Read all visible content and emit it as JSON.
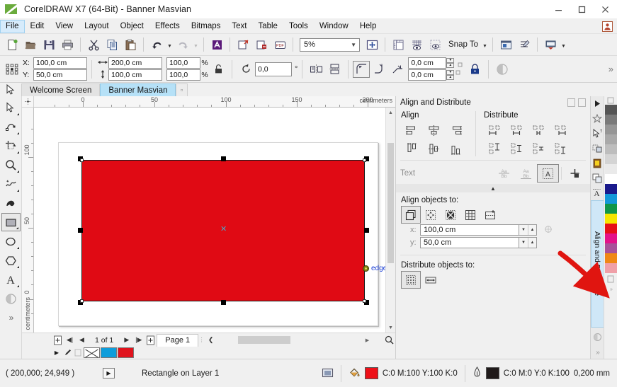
{
  "window": {
    "title": "CorelDRAW X7 (64-Bit) - Banner Masvian",
    "minimize": "—",
    "maximize": "□",
    "close": "✕"
  },
  "menubar": {
    "items": [
      {
        "label": "File"
      },
      {
        "label": "Edit"
      },
      {
        "label": "View"
      },
      {
        "label": "Layout"
      },
      {
        "label": "Object"
      },
      {
        "label": "Effects"
      },
      {
        "label": "Bitmaps"
      },
      {
        "label": "Text"
      },
      {
        "label": "Table"
      },
      {
        "label": "Tools"
      },
      {
        "label": "Window"
      },
      {
        "label": "Help"
      }
    ]
  },
  "toolbar": {
    "zoom_level": "5%",
    "snap_to_label": "Snap To",
    "buttons": [
      {
        "name": "new-document",
        "tip": "New"
      },
      {
        "name": "open-document",
        "tip": "Open"
      },
      {
        "name": "save-document",
        "tip": "Save"
      },
      {
        "name": "print-document",
        "tip": "Print"
      },
      {
        "name": "cut",
        "tip": "Cut"
      },
      {
        "name": "copy",
        "tip": "Copy"
      },
      {
        "name": "paste",
        "tip": "Paste"
      },
      {
        "name": "undo",
        "tip": "Undo"
      },
      {
        "name": "redo",
        "tip": "Redo"
      },
      {
        "name": "corel-connect",
        "tip": "Search Content"
      },
      {
        "name": "import",
        "tip": "Import"
      },
      {
        "name": "export",
        "tip": "Export"
      },
      {
        "name": "publish-pdf",
        "tip": "Publish to PDF"
      },
      {
        "name": "fullscreen-preview",
        "tip": "Full-Screen Preview"
      },
      {
        "name": "show-rulers",
        "tip": "Rulers"
      },
      {
        "name": "show-grid",
        "tip": "Grid"
      },
      {
        "name": "show-guidelines",
        "tip": "Guidelines"
      },
      {
        "name": "options",
        "tip": "Options"
      },
      {
        "name": "object-styles",
        "tip": "Object Styles"
      },
      {
        "name": "application-launcher",
        "tip": "Application Launcher"
      }
    ]
  },
  "propertybar": {
    "x_label": "X:",
    "y_label": "Y:",
    "x_value": "100,0 cm",
    "y_value": "50,0 cm",
    "width_value": "200,0 cm",
    "height_value": "100,0 cm",
    "scale_w": "100,0",
    "scale_h": "100,0",
    "percent": "%",
    "rotation": "0,0",
    "degree": "°",
    "outline_top": "0,0 cm",
    "outline_bottom": "0,0 cm",
    "overflow": "»"
  },
  "tabs": {
    "items": [
      {
        "label": "Welcome Screen",
        "active": false
      },
      {
        "label": "Banner Masvian",
        "active": true
      }
    ],
    "close_glyph": "▫"
  },
  "toolbox": {
    "tools": [
      {
        "name": "pick-tool",
        "label": "Pick",
        "selected": false
      },
      {
        "name": "shape-tool",
        "label": "Shape",
        "selected": false
      },
      {
        "name": "crop-tool",
        "label": "Crop",
        "selected": false
      },
      {
        "name": "zoom-tool",
        "label": "Zoom",
        "selected": false
      },
      {
        "name": "freehand-tool",
        "label": "Freehand",
        "selected": false
      },
      {
        "name": "artistic-media-tool",
        "label": "Artistic Media",
        "selected": false
      },
      {
        "name": "rectangle-tool",
        "label": "Rectangle",
        "selected": true
      },
      {
        "name": "ellipse-tool",
        "label": "Ellipse",
        "selected": false
      },
      {
        "name": "polygon-tool",
        "label": "Polygon",
        "selected": false
      },
      {
        "name": "text-tool",
        "label": "Text",
        "selected": false
      },
      {
        "name": "transparency-tool",
        "label": "Transparency",
        "selected": false
      },
      {
        "name": "more-tools",
        "label": "»",
        "selected": false
      }
    ]
  },
  "canvas": {
    "h_ruler": {
      "unit": "centimeters",
      "labels": [
        "0",
        "50",
        "100",
        "150",
        "200"
      ]
    },
    "v_ruler": {
      "unit": "centimeters",
      "labels": [
        "100",
        "50",
        "0"
      ]
    },
    "object": {
      "name": "rectangle",
      "fill_hex": "#e00a14",
      "outline_hex": "#1a1a1a"
    },
    "snap_hint": "edge"
  },
  "pagenav": {
    "add_page_left": "+",
    "first": "◀|",
    "prev": "◀",
    "counter": "1 of 1",
    "next": "▶",
    "last": "|▶",
    "add_page_right": "+",
    "page_tab": "Page 1",
    "collapse": "❮"
  },
  "colorstatus": {
    "none_label": "No Fill",
    "swatches": [
      "#ffffff",
      "#0d9ddb",
      "#e0121c"
    ]
  },
  "docker": {
    "title": "Align and Distribute",
    "align": {
      "title": "Align",
      "buttons": [
        {
          "name": "align-left"
        },
        {
          "name": "align-center-horizontal"
        },
        {
          "name": "align-right"
        },
        {
          "name": "align-top"
        },
        {
          "name": "align-center-vertical"
        },
        {
          "name": "align-bottom"
        }
      ]
    },
    "distribute": {
      "title": "Distribute",
      "buttons": [
        {
          "name": "distribute-left"
        },
        {
          "name": "distribute-center-horizontal"
        },
        {
          "name": "distribute-spacing-horizontal"
        },
        {
          "name": "distribute-right"
        },
        {
          "name": "distribute-top"
        },
        {
          "name": "distribute-center-vertical"
        },
        {
          "name": "distribute-spacing-vertical"
        },
        {
          "name": "distribute-bottom"
        }
      ]
    },
    "text": {
      "label": "Text",
      "buttons": [
        {
          "name": "align-text-first-line-baseline"
        },
        {
          "name": "align-text-last-line-baseline"
        },
        {
          "name": "align-text-bounding-box"
        },
        {
          "name": "align-to-point"
        }
      ]
    },
    "collapse_glyph": "▲",
    "align_objects_to": {
      "label": "Align objects to:",
      "buttons": [
        {
          "name": "active-objects",
          "selected": true
        },
        {
          "name": "page-edge",
          "selected": false
        },
        {
          "name": "page-center",
          "selected": false
        },
        {
          "name": "grid",
          "selected": false
        },
        {
          "name": "specified-point",
          "selected": false
        }
      ]
    },
    "coords": {
      "x_label": "x:",
      "y_label": "y:",
      "x_value": "100,0 cm",
      "y_value": "50,0 cm"
    },
    "distribute_objects_to": {
      "label": "Distribute objects to:",
      "buttons": [
        {
          "name": "selection-extent",
          "selected": true
        },
        {
          "name": "page-extent",
          "selected": false
        }
      ]
    },
    "tabs": [
      {
        "name": "favorites-docker",
        "label": "Favorites"
      },
      {
        "name": "hints-docker",
        "label": "Hints"
      },
      {
        "name": "object-properties-docker",
        "label": "Object Properties"
      },
      {
        "name": "color-styles-docker",
        "label": "Color Styles"
      },
      {
        "name": "object-manager-docker",
        "label": "Object Manager"
      },
      {
        "name": "font-playground-docker",
        "label": "Font Playground"
      },
      {
        "name": "align-distribute-docker",
        "label": "Align and Distribute",
        "active": true
      }
    ]
  },
  "palette": {
    "swatches": [
      "#555555",
      "#7a7a7a",
      "#969696",
      "#a9a9a9",
      "#bdbdbd",
      "#d4d4d4",
      "#eaeaea",
      "#ffffff",
      "#1a1a8c",
      "#1398d8",
      "#0f9648",
      "#f5e500",
      "#e60f18",
      "#e3128a",
      "#a8519a",
      "#ef8816",
      "#f0a0a8"
    ]
  },
  "statusbar": {
    "coords": "( 200,000; 24,949 )",
    "play_glyph": "▶",
    "object_info": "Rectangle on Layer 1",
    "fill": {
      "icon": "fill-icon",
      "swatch_hex": "#ee1018",
      "value": "C:0 M:100 Y:100 K:0"
    },
    "outline": {
      "icon": "outline-pen-icon",
      "swatch_hex": "#201a1a",
      "value": "C:0 M:0 Y:0 K:100",
      "width": "0,200 mm"
    }
  }
}
